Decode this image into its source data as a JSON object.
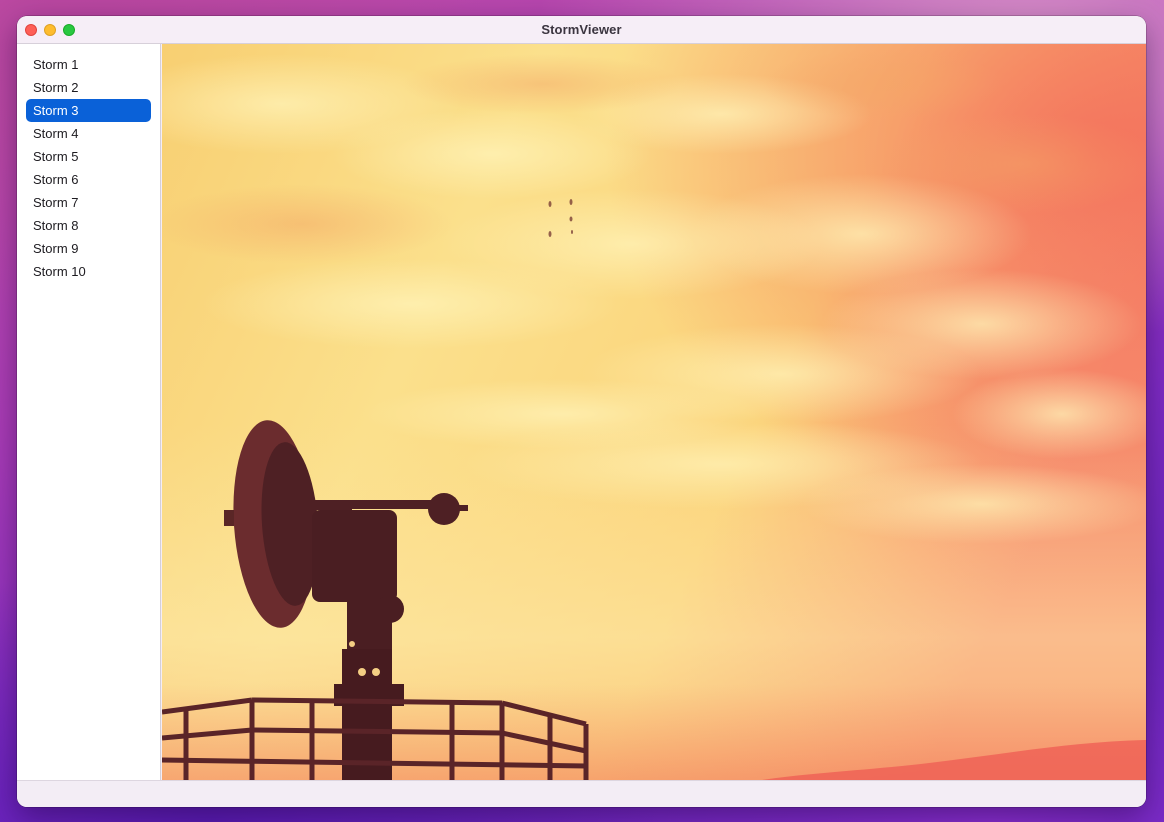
{
  "window": {
    "title": "StormViewer"
  },
  "sidebar": {
    "items": [
      {
        "label": "Storm 1",
        "selected": false
      },
      {
        "label": "Storm 2",
        "selected": false
      },
      {
        "label": "Storm 3",
        "selected": true
      },
      {
        "label": "Storm 4",
        "selected": false
      },
      {
        "label": "Storm 5",
        "selected": false
      },
      {
        "label": "Storm 6",
        "selected": false
      },
      {
        "label": "Storm 7",
        "selected": false
      },
      {
        "label": "Storm 8",
        "selected": false
      },
      {
        "label": "Storm 9",
        "selected": false
      },
      {
        "label": "Storm 10",
        "selected": false
      }
    ]
  },
  "colors": {
    "selection": "#0a61d8",
    "traffic_close": "#fe5f57",
    "traffic_minimize": "#febc2e",
    "traffic_zoom": "#28c840"
  },
  "image": {
    "subject": "radar-dish-silhouette-against-storm-sky"
  }
}
